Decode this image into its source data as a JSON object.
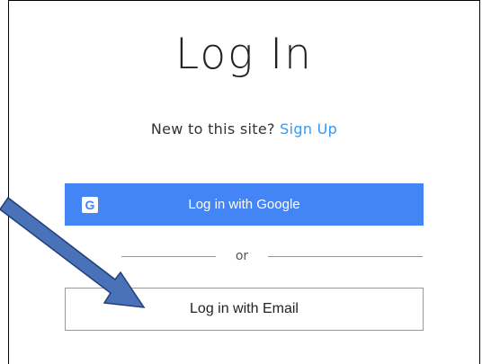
{
  "login": {
    "title": "Log In",
    "signup_prompt": "New to this site?",
    "signup_link": "Sign Up",
    "google_button": "Log in with Google",
    "google_logo_letter": "G",
    "divider_text": "or",
    "email_button": "Log in with Email"
  },
  "colors": {
    "google_blue": "#4385f5",
    "link_blue": "#3899ec",
    "arrow_blue": "#4a72b8"
  },
  "icons": {
    "google_logo": "google-g-logo",
    "annotation": "blue-arrow"
  }
}
